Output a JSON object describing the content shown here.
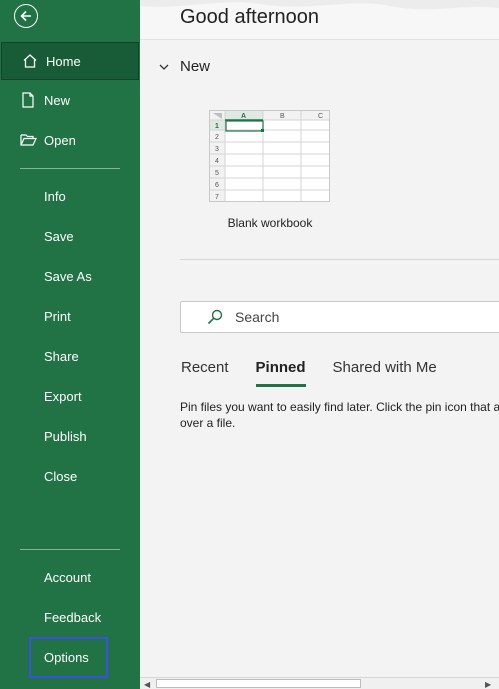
{
  "sidebar": {
    "back_label": "Back",
    "items_top": [
      {
        "label": "Home",
        "icon": "home-icon"
      },
      {
        "label": "New",
        "icon": "new-file-icon"
      },
      {
        "label": "Open",
        "icon": "folder-open-icon"
      }
    ],
    "items_mid": [
      "Info",
      "Save",
      "Save As",
      "Print",
      "Share",
      "Export",
      "Publish",
      "Close"
    ],
    "items_bottom": [
      "Account",
      "Feedback",
      "Options"
    ]
  },
  "main": {
    "greeting": "Good afternoon",
    "new_section": {
      "title": "New",
      "template_label": "Blank workbook"
    },
    "template_grid": {
      "columns": [
        "A",
        "B",
        "C"
      ],
      "rows": [
        "1",
        "2",
        "3",
        "4",
        "5",
        "6",
        "7"
      ]
    },
    "search": {
      "placeholder": "Search"
    },
    "tabs": [
      "Recent",
      "Pinned",
      "Shared with Me"
    ],
    "active_tab": "Pinned",
    "pinned_message": "Pin files you want to easily find later. Click the pin icon that a over a file."
  },
  "colors": {
    "accent": "#217346",
    "accent_dark": "#185c37",
    "focus": "#3b4fe0"
  }
}
